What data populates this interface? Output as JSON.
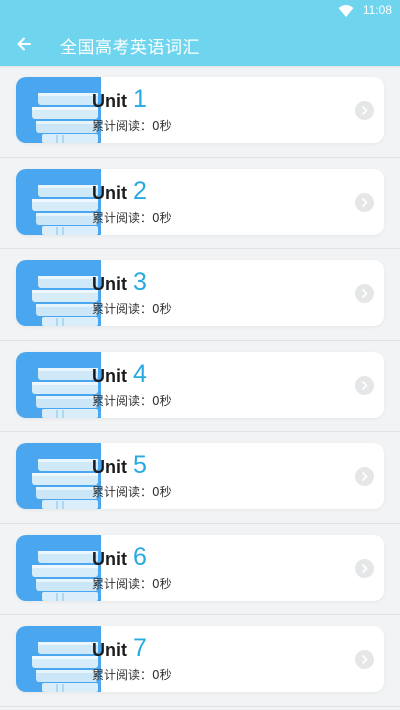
{
  "status_bar": {
    "time": "11:08",
    "wifi_icon": "wifi-icon"
  },
  "app_bar": {
    "back_icon": "arrow-left-icon",
    "title": "全国高考英语词汇"
  },
  "units": [
    {
      "word": "Unit",
      "number": "1",
      "reading": "累计阅读：0秒"
    },
    {
      "word": "Unit",
      "number": "2",
      "reading": "累计阅读：0秒"
    },
    {
      "word": "Unit",
      "number": "3",
      "reading": "累计阅读：0秒"
    },
    {
      "word": "Unit",
      "number": "4",
      "reading": "累计阅读：0秒"
    },
    {
      "word": "Unit",
      "number": "5",
      "reading": "累计阅读：0秒"
    },
    {
      "word": "Unit",
      "number": "6",
      "reading": "累计阅读：0秒"
    },
    {
      "word": "Unit",
      "number": "7",
      "reading": "累计阅读：0秒"
    }
  ],
  "colors": {
    "app_bar": "#6fd4ee",
    "unit_number": "#27a9e1",
    "thumb_blue": "#4aa7ef",
    "page_bg": "#f1f3f5"
  }
}
